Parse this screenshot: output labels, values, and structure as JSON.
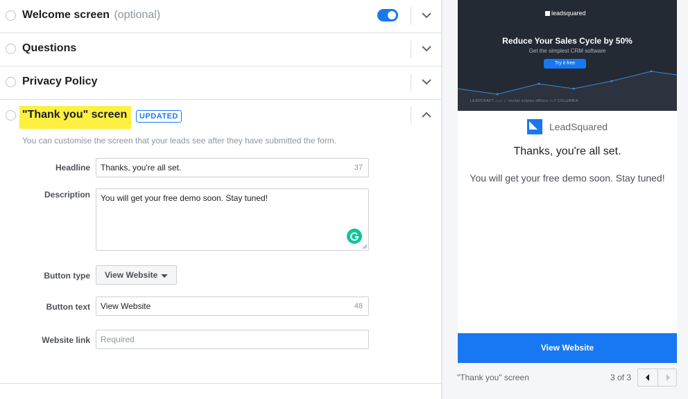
{
  "sections": {
    "welcome": {
      "title": "Welcome screen",
      "optional": "(optional)"
    },
    "questions": {
      "title": "Questions"
    },
    "privacy": {
      "title": "Privacy Policy"
    },
    "thankyou": {
      "title": "\"Thank you\" screen",
      "badge": "UPDATED",
      "helper": "You can customise the screen that your leads see after they have submitted the form."
    }
  },
  "form": {
    "headline": {
      "label": "Headline",
      "value": "Thanks, you're all set.",
      "count": "37"
    },
    "description": {
      "label": "Description",
      "value": "You will get your free demo soon. Stay tuned!"
    },
    "button_type": {
      "label": "Button type",
      "value": "View Website"
    },
    "button_text": {
      "label": "Button text",
      "value": "View Website",
      "count": "48"
    },
    "website_link": {
      "label": "Website link",
      "placeholder": "Required"
    }
  },
  "preview": {
    "banner": {
      "logo": "leadsquared",
      "headline": "Reduce Your Sales Cycle by 50%",
      "subline": "Get the simplest CRM software",
      "cta": "Try it free",
      "logos": "LEADCRAFT   ▭▭   ✓ revital   sciplex   dBlocx   ▭   ⁄⁄   COLUMBIA"
    },
    "brand": "LeadSquared",
    "headline": "Thanks, you're all set.",
    "description": "You will get your free demo soon. Stay tuned!",
    "button": "View Website",
    "footer_label": "\"Thank you\" screen",
    "page": "3 of 3"
  },
  "colors": {
    "accent": "#1877f2",
    "highlight": "#fdf040",
    "banner": "#242a33"
  }
}
